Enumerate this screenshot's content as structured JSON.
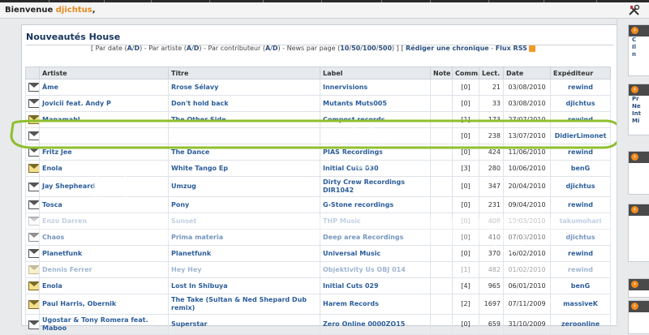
{
  "header": {
    "welcome_prefix": "Bienvenue ",
    "username": "djichtus",
    "welcome_suffix": ","
  },
  "panel": {
    "title": "Nouveautés House",
    "filters": {
      "open": "[ Par date (",
      "date_a": "A",
      "sep1": "/",
      "date_d": "D",
      "t1": ") - Par artiste (",
      "artist_a": "A",
      "sep2": "/",
      "artist_d": "D",
      "t2": ") - Par contributeur (",
      "contrib_a": "A",
      "sep3": "/",
      "contrib_d": "D",
      "t3": ") - News par page (",
      "pp10": "10",
      "sep4": "/",
      "pp50": "50",
      "sep5": "/",
      "pp100": "100",
      "sep6": "/",
      "pp500": "500",
      "t4": ") ] [ ",
      "write_review": "Rédiger une chronique",
      "t5": " - ",
      "rss_feed": "Flux RSS"
    }
  },
  "table": {
    "headers": [
      "",
      "Artiste",
      "Titre",
      "Label",
      "Note",
      "Comm.",
      "Lect.",
      "Date",
      "Expéditeur"
    ],
    "rows": [
      {
        "artist": "Âme",
        "title": "Rrose Sélavy",
        "label": "Innervisions",
        "note": "",
        "comm": "[0]",
        "lect": "21",
        "date": "03/08/2010",
        "sender": "rewind",
        "open": false
      },
      {
        "artist": "Jovicii feat. Andy P",
        "title": "Don't hold back",
        "label": "Mutants Muts005",
        "note": "",
        "comm": "[0]",
        "lect": "33",
        "date": "03/08/2010",
        "sender": "djichtus",
        "open": false
      },
      {
        "artist": "Manamahl",
        "title": "The Other Side",
        "label": "Compost records",
        "note": "",
        "comm": "[1]",
        "lect": "173",
        "date": "27/07/2010",
        "sender": "rewind",
        "open": true
      },
      {
        "artist": "",
        "title": "",
        "label": "",
        "note": "",
        "comm": "[0]",
        "lect": "238",
        "date": "13/07/2010",
        "sender": "DidierLimonet",
        "open": false
      },
      {
        "artist": "Fritz Jee",
        "title": "The Dance",
        "label": "PIAS Recordings",
        "note": "",
        "comm": "[0]",
        "lect": "424",
        "date": "11/06/2010",
        "sender": "rewind",
        "open": false
      },
      {
        "artist": "Enola",
        "title": "White Tango Ep",
        "label": "Initial Cuts 030",
        "note": "",
        "comm": "[3]",
        "lect": "280",
        "date": "10/06/2010",
        "sender": "benG",
        "open": true
      },
      {
        "artist": "Jay Shepheard",
        "title": "Umzug",
        "label": "Dirty Crew Recordings DIR1042",
        "note": "",
        "comm": "[0]",
        "lect": "347",
        "date": "20/04/2010",
        "sender": "djichtus",
        "open": false,
        "tall": true
      },
      {
        "artist": "Tosca",
        "title": "Pony",
        "label": "G-Stone recordings",
        "note": "",
        "comm": "[0]",
        "lect": "231",
        "date": "09/04/2010",
        "sender": "rewind",
        "open": false
      },
      {
        "artist": "Enzo Darren",
        "title": "Sunset",
        "label": "THP Music",
        "note": "",
        "comm": "[0]",
        "lect": "408",
        "date": "19/03/2010",
        "sender": "takumohari",
        "open": false,
        "faded": true
      },
      {
        "artist": "Chaos",
        "title": "Prima materia",
        "label": "Deep area Recordings",
        "note": "",
        "comm": "[0]",
        "lect": "410",
        "date": "07/03/2010",
        "sender": "djichtus",
        "open": false
      },
      {
        "artist": "Planetfunk",
        "title": "Planetfunk",
        "label": "Universal Music",
        "note": "",
        "comm": "[0]",
        "lect": "370",
        "date": "16/02/2010",
        "sender": "rewind",
        "open": false
      },
      {
        "artist": "Dennis Ferrer",
        "title": "Hey Hey",
        "label": "Objektivity Us OBJ 014",
        "note": "",
        "comm": "[1]",
        "lect": "482",
        "date": "01/02/2010",
        "sender": "rewind",
        "open": true,
        "faded": true
      },
      {
        "artist": "Enola",
        "title": "Lost In Shibuya",
        "label": "Initial Cuts 029",
        "note": "",
        "comm": "[4]",
        "lect": "965",
        "date": "06/01/2010",
        "sender": "benG",
        "open": true
      },
      {
        "artist": "Paul Harris, Obernik",
        "title": "The Take (Sultan & Ned Shepard Dub remix)",
        "label": "Harem Records",
        "note": "",
        "comm": "[2]",
        "lect": "1697",
        "date": "07/11/2009",
        "sender": "massiveK",
        "open": true,
        "tall": true
      },
      {
        "artist": "Ugostar & Tony Romera feat. Maboo",
        "title": "Superstar",
        "label": "Zero Online 0000ZO15",
        "note": "",
        "comm": "[0]",
        "lect": "659",
        "date": "31/10/2009",
        "sender": "zeroonline",
        "open": false,
        "tall": true
      }
    ]
  },
  "sidebar": {
    "boxes": [
      {
        "lines": [
          "C",
          "Il",
          "n"
        ]
      },
      {
        "lines": [
          "Pr",
          "Ne",
          "Int",
          "Mi"
        ]
      },
      {
        "lines": []
      },
      {
        "lines": []
      },
      {
        "lines": []
      },
      {
        "lines": []
      }
    ]
  },
  "colors": {
    "accent_orange": "#f08a1c",
    "link_blue": "#2b5d9a",
    "highlight_green": "#8fbf2e"
  }
}
